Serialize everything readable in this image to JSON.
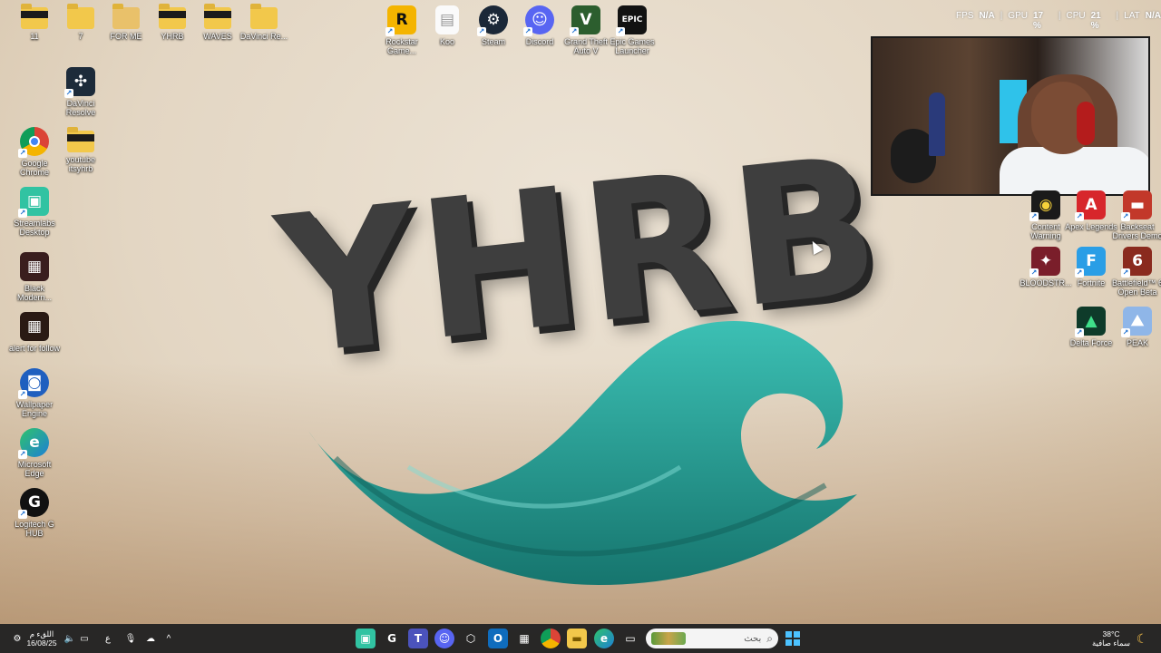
{
  "hud": {
    "fps_label": "FPS",
    "fps_value": "N/A",
    "gpu_label": "GPU",
    "gpu_value": "17 %",
    "cpu_label": "CPU",
    "cpu_value": "21 %",
    "lat_label": "LAT",
    "lat_value": "N/A"
  },
  "wallpaper": {
    "logo_text": "YHRB"
  },
  "desktop": {
    "top_row": [
      {
        "label": "11",
        "icon": "folder-icon"
      },
      {
        "label": "7",
        "icon": "folder-icon"
      },
      {
        "label": "FOR ME",
        "icon": "folder-icon"
      },
      {
        "label": "YHRB",
        "icon": "folder-icon"
      },
      {
        "label": "WAVES",
        "icon": "folder-icon"
      },
      {
        "label": "DaVinci Re...",
        "icon": "folder-icon"
      },
      {
        "label": "Rockstar Game...",
        "icon": "rockstar-icon"
      },
      {
        "label": "Koo",
        "icon": "document-icon"
      },
      {
        "label": "Steam",
        "icon": "steam-icon"
      },
      {
        "label": "Discord",
        "icon": "discord-icon"
      },
      {
        "label": "Grand Theft Auto V",
        "icon": "gta-icon"
      },
      {
        "label": "Epic Games Launcher",
        "icon": "epic-icon"
      }
    ],
    "left_column": [
      {
        "label": "DaVinci Resolve",
        "icon": "davinci-icon"
      },
      {
        "label": "Google Chrome",
        "icon": "chrome-icon"
      },
      {
        "label": "youtube itsyhrb",
        "icon": "folder-icon"
      },
      {
        "label": "Streamlabs Desktop",
        "icon": "streamlabs-icon"
      },
      {
        "label": "Black Modern...",
        "icon": "image-icon"
      },
      {
        "label": "alert for follow",
        "icon": "image-icon"
      },
      {
        "label": "Wallpaper Engine",
        "icon": "wallpaper-engine-icon"
      },
      {
        "label": "Microsoft Edge",
        "icon": "edge-icon"
      },
      {
        "label": "Logitech G HUB",
        "icon": "logitech-icon"
      }
    ],
    "right_column": [
      {
        "label": "Content Warning",
        "icon": "content-warning-icon"
      },
      {
        "label": "Apex Legends",
        "icon": "apex-icon"
      },
      {
        "label": "Backseat Drivers Demo",
        "icon": "backseat-icon"
      },
      {
        "label": "BLOODSTR...",
        "icon": "bloodstrike-icon"
      },
      {
        "label": "Fortnite",
        "icon": "fortnite-icon"
      },
      {
        "label": "Battlefield™ 6 Open Beta",
        "icon": "battlefield-icon"
      },
      {
        "label": "Delta Force",
        "icon": "delta-force-icon"
      },
      {
        "label": "PEAK",
        "icon": "peak-icon"
      }
    ]
  },
  "taskbar": {
    "clock_time": "اللقء م",
    "clock_date": "16/08/25",
    "lang": "ع",
    "search_placeholder": "بحث",
    "weather_temp": "38°C",
    "weather_desc": "سماء صافية"
  },
  "colors": {
    "taskbar_bg": "#202020",
    "logo_gray": "#3e3e3e",
    "wave_teal": "#2aa39a",
    "accent_blue": "#4cc2ff"
  }
}
